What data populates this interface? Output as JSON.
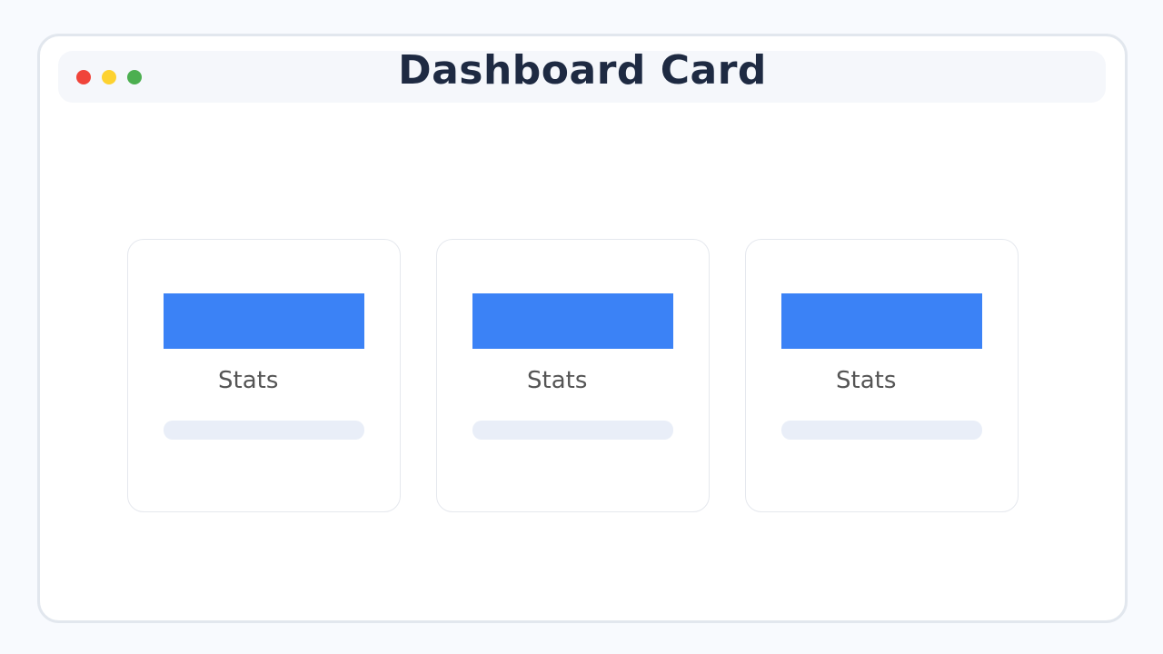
{
  "window": {
    "title": "Dashboard Card",
    "controls": [
      {
        "name": "close-dot",
        "color": "#f0443a"
      },
      {
        "name": "minimize-dot",
        "color": "#fdd230"
      },
      {
        "name": "maximize-dot",
        "color": "#4caf50"
      }
    ]
  },
  "cards": [
    {
      "label": "Stats",
      "accent": "#3b82f6"
    },
    {
      "label": "Stats",
      "accent": "#3b82f6"
    },
    {
      "label": "Stats",
      "accent": "#3b82f6"
    }
  ]
}
